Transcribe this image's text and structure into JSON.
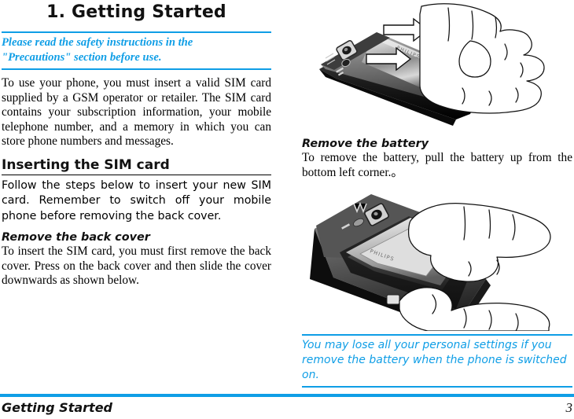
{
  "document": {
    "chapter_title": "1. Getting Started",
    "footer": {
      "section_label": "Getting Started",
      "page_number": "3"
    },
    "accent_color": "#0f9ee6",
    "text_color": "#000000"
  },
  "left_column": {
    "safety_note": {
      "line1": "Please read the safety instructions in the",
      "line2": "\"Precautions\" section before use."
    },
    "intro_paragraph": "To use your phone, you must insert a valid SIM card supplied by a GSM operator or retailer. The SIM card contains your subscription information, your mobile telephone number, and a memory in which you can store phone numbers and messages.",
    "section_heading": "Inserting the SIM card",
    "section_paragraph": "Follow the steps below to insert your new SIM card. Remember to switch off your mobile phone before removing the back cover.",
    "sub_heading": "Remove the back cover",
    "sub_paragraph": "To insert the SIM card, you must first remove the back cover. Press on the back cover and then slide the cover downwards as shown below."
  },
  "right_column": {
    "figure_top": {
      "caption": "",
      "alt": "Hand holding phone, sliding the back cover off in the direction of the arrows",
      "brand_on_phone": "PHILIPS"
    },
    "sub_heading": "Remove the battery",
    "sub_paragraph": "To remove the battery, pull the battery up from the bottom left corner.。",
    "figure_bottom": {
      "caption": "",
      "alt": "Two hands lifting the battery out of the opened phone",
      "brand_on_battery": "PHILIPS"
    },
    "warning_note": {
      "line1": "You may lose all your personal settings if you",
      "line2": "remove the battery when the phone is switched",
      "line3": "on."
    }
  }
}
